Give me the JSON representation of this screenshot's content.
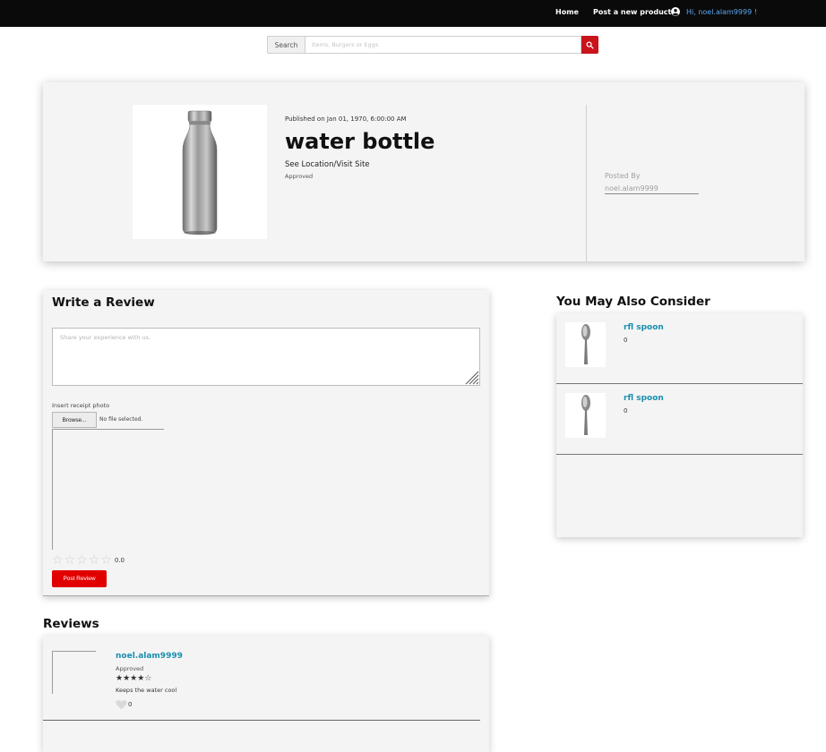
{
  "nav": {
    "home": "Home",
    "post_product": "Post a new product",
    "user_greeting": "Hi, noel.alam9999 !"
  },
  "search": {
    "label": "Search",
    "placeholder": "Items, Burgers or Eggs"
  },
  "product": {
    "published": "Published on Jan 01, 1970, 6:00:00 AM",
    "title": "water bottle",
    "see_location": "See Location/Visit Site",
    "status": "Approved",
    "posted_by_label": "Posted By",
    "posted_by_user": "noel.alam9999"
  },
  "write_review": {
    "title": "Write a Review",
    "textarea_placeholder": "Share your experience with us.",
    "receipt_label": "Insert receipt photo",
    "browse_label": "Browse...",
    "no_file": "No file selected.",
    "rating_value": "0.0",
    "rating_stars": [
      "☆",
      "☆",
      "☆",
      "☆",
      "☆"
    ],
    "post_button": "Post Review"
  },
  "reviews": {
    "title": "Reviews",
    "items": [
      {
        "user": "noel.alam9999",
        "status": "Approved",
        "stars": [
          "★",
          "★",
          "★",
          "★",
          "☆"
        ],
        "rating": 4,
        "text": "Keeps the water cool",
        "likes": "0"
      }
    ]
  },
  "consider": {
    "title": "You May Also Consider",
    "items": [
      {
        "name": "rfl spoon",
        "count": "0"
      },
      {
        "name": "rfl spoon",
        "count": "0"
      }
    ]
  },
  "colors": {
    "nav_bg": "#0a0a0a",
    "accent_red": "#e10000",
    "link_teal": "#1a8fae",
    "user_blue": "#5aa9f0"
  },
  "icons": {
    "user": "user-circle-icon",
    "search": "search-icon",
    "like": "heart-icon",
    "star": "star-icon"
  }
}
